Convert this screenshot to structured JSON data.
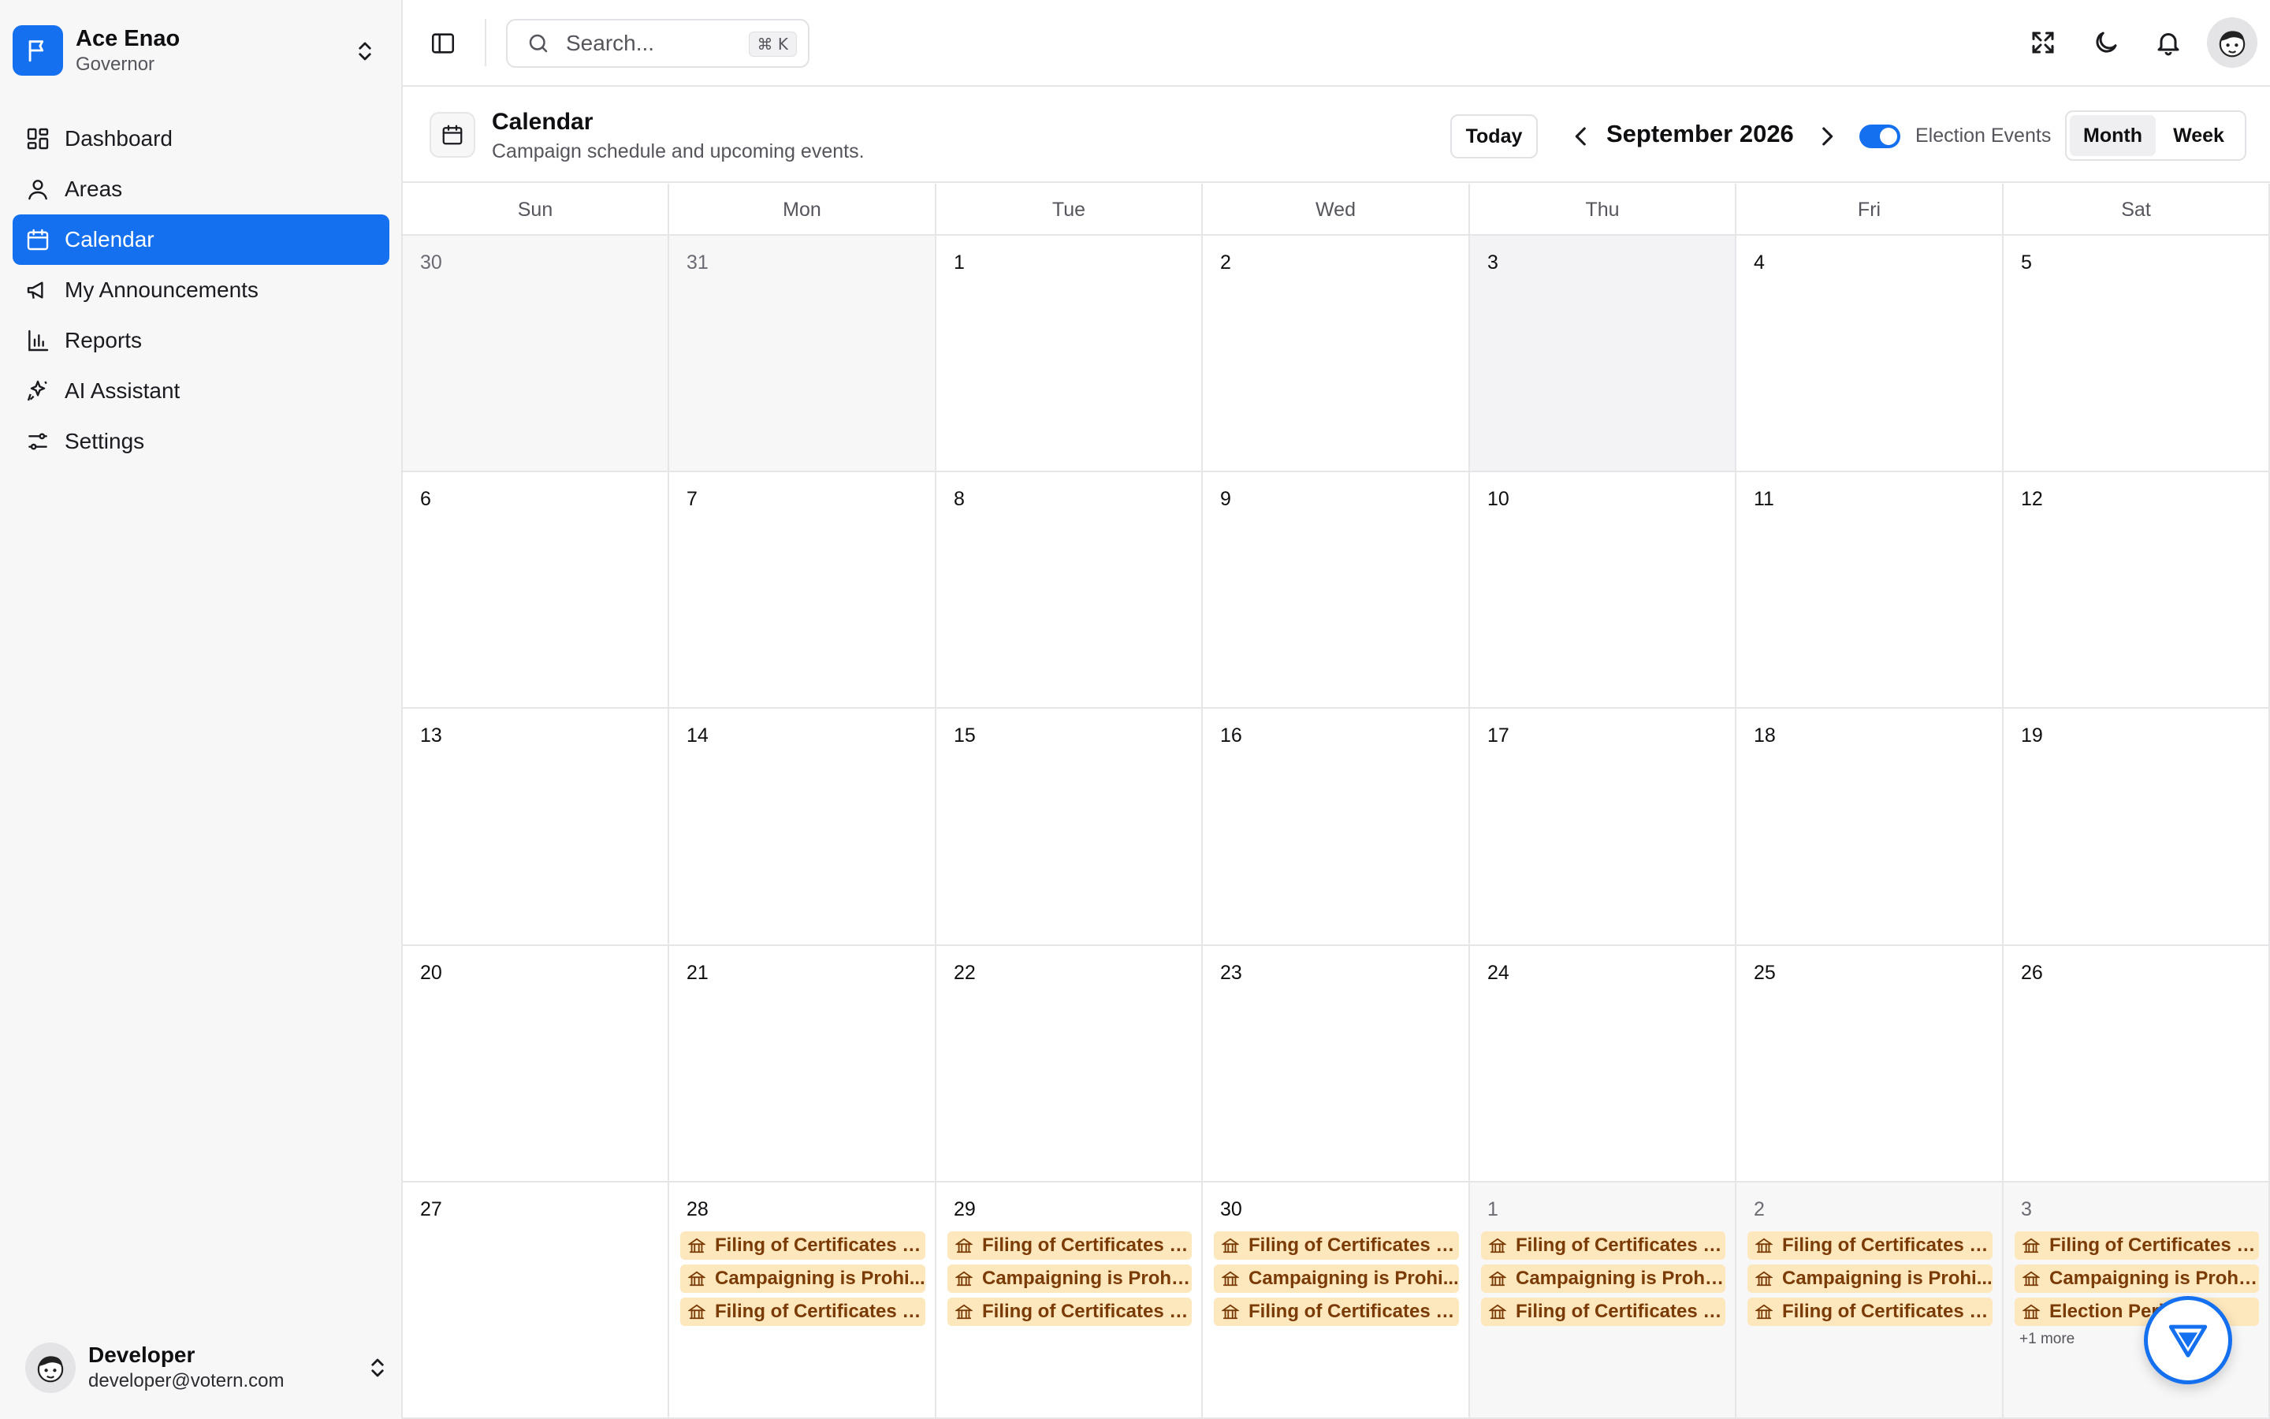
{
  "org": {
    "name": "Ace Enao",
    "role": "Governor"
  },
  "nav": [
    {
      "label": "Dashboard",
      "icon": "dashboard-icon",
      "active": false
    },
    {
      "label": "Areas",
      "icon": "map-pin-icon",
      "active": false
    },
    {
      "label": "Calendar",
      "icon": "calendar-icon",
      "active": true
    },
    {
      "label": "My Announcements",
      "icon": "megaphone-icon",
      "active": false
    },
    {
      "label": "Reports",
      "icon": "bar-chart-icon",
      "active": false
    },
    {
      "label": "AI Assistant",
      "icon": "sparkles-icon",
      "active": false
    },
    {
      "label": "Settings",
      "icon": "sliders-icon",
      "active": false
    }
  ],
  "user": {
    "name": "Developer",
    "email": "developer@votern.com"
  },
  "topbar": {
    "search_placeholder": "Search...",
    "search_shortcut": "⌘ K"
  },
  "calendar": {
    "title": "Calendar",
    "subtitle": "Campaign schedule and upcoming events.",
    "today_label": "Today",
    "month_label": "September 2026",
    "toggle_label": "Election Events",
    "toggle_on": true,
    "views": [
      "Month",
      "Week"
    ],
    "active_view": "Month",
    "weekdays": [
      "Sun",
      "Mon",
      "Tue",
      "Wed",
      "Thu",
      "Fri",
      "Sat"
    ],
    "weeks": [
      [
        {
          "day": "30",
          "muted": true
        },
        {
          "day": "31",
          "muted": true
        },
        {
          "day": "1"
        },
        {
          "day": "2"
        },
        {
          "day": "3",
          "highlight": true
        },
        {
          "day": "4"
        },
        {
          "day": "5"
        }
      ],
      [
        {
          "day": "6"
        },
        {
          "day": "7"
        },
        {
          "day": "8"
        },
        {
          "day": "9"
        },
        {
          "day": "10"
        },
        {
          "day": "11"
        },
        {
          "day": "12"
        }
      ],
      [
        {
          "day": "13"
        },
        {
          "day": "14"
        },
        {
          "day": "15"
        },
        {
          "day": "16"
        },
        {
          "day": "17"
        },
        {
          "day": "18"
        },
        {
          "day": "19"
        }
      ],
      [
        {
          "day": "20"
        },
        {
          "day": "21"
        },
        {
          "day": "22"
        },
        {
          "day": "23"
        },
        {
          "day": "24"
        },
        {
          "day": "25"
        },
        {
          "day": "26"
        }
      ],
      [
        {
          "day": "27"
        },
        {
          "day": "28",
          "events": [
            "Filing of Certificates o...",
            "Campaigning is Prohi...",
            "Filing of Certificates o..."
          ]
        },
        {
          "day": "29",
          "events": [
            "Filing of Certificates o...",
            "Campaigning is Prohi...",
            "Filing of Certificates o..."
          ]
        },
        {
          "day": "30",
          "events": [
            "Filing of Certificates o...",
            "Campaigning is Prohi...",
            "Filing of Certificates o..."
          ]
        },
        {
          "day": "1",
          "muted": true,
          "events": [
            "Filing of Certificates o...",
            "Campaigning is Prohi...",
            "Filing of Certificates o..."
          ]
        },
        {
          "day": "2",
          "muted": true,
          "events": [
            "Filing of Certificates o...",
            "Campaigning is Prohi...",
            "Filing of Certificates o..."
          ]
        },
        {
          "day": "3",
          "muted": true,
          "events": [
            "Filing of Certificates o...",
            "Campaigning is Prohi...",
            "Election Peri... B..."
          ],
          "more": "+1 more"
        }
      ]
    ]
  },
  "colors": {
    "accent": "#1570ef",
    "event_bg": "#fde7bd",
    "event_text": "#7a3b06"
  }
}
